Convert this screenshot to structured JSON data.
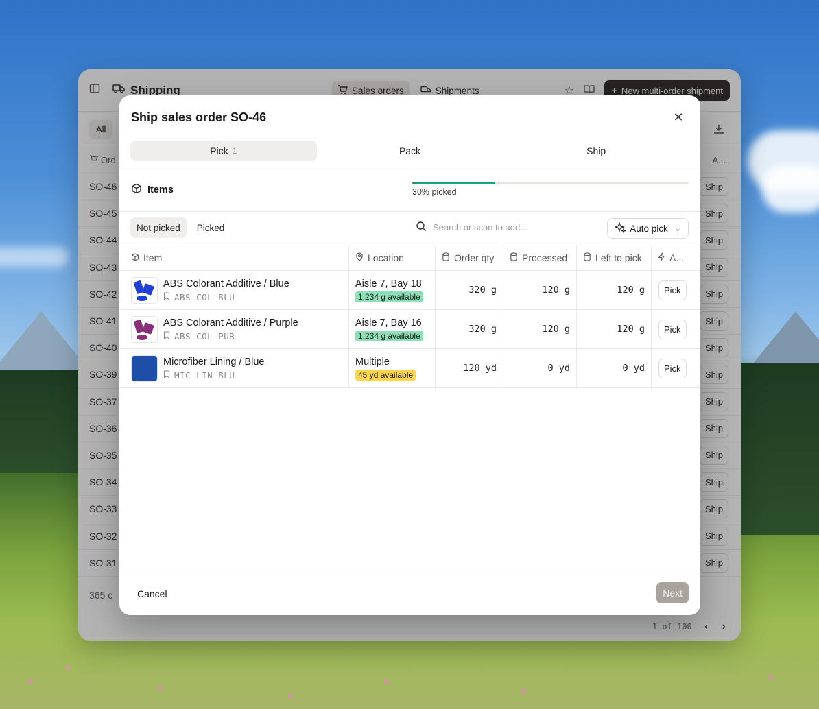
{
  "app": {
    "title": "Shipping",
    "nav": [
      {
        "label": "Sales orders",
        "active": true
      },
      {
        "label": "Shipments",
        "active": false
      }
    ],
    "new_shipment_label": "New multi-order shipment",
    "filter_all": "All",
    "column_order": "Ord",
    "column_a": "A...",
    "orders": [
      "SO-46",
      "SO-45",
      "SO-44",
      "SO-43",
      "SO-42",
      "SO-41",
      "SO-40",
      "SO-39",
      "SO-37",
      "SO-36",
      "SO-35",
      "SO-34",
      "SO-33",
      "SO-32",
      "SO-31"
    ],
    "ship_label": "Ship",
    "count_text": "365 c",
    "pager_text": "1 of 100"
  },
  "modal": {
    "title": "Ship sales order SO-46",
    "steps": [
      {
        "label": "Pick",
        "count": "1",
        "active": true
      },
      {
        "label": "Pack",
        "count": "",
        "active": false
      },
      {
        "label": "Ship",
        "count": "",
        "active": false
      }
    ],
    "items_label": "Items",
    "progress_percent": 30,
    "progress_text": "30% picked",
    "subtabs": [
      {
        "label": "Not picked",
        "active": true
      },
      {
        "label": "Picked",
        "active": false
      }
    ],
    "search_placeholder": "Search or scan to add...",
    "auto_pick_label": "Auto pick",
    "columns": {
      "item": "Item",
      "location": "Location",
      "order_qty": "Order qty",
      "processed": "Processed",
      "left_to_pick": "Left to pick",
      "actions": "A..."
    },
    "rows": [
      {
        "name": "ABS Colorant Additive / Blue",
        "sku": "ABS-COL-BLU",
        "location": "Aisle 7, Bay 18",
        "availability": "1,234 g available",
        "availability_color": "#8fe0b8",
        "order_qty": "320 g",
        "processed": "120 g",
        "left": "120 g",
        "action": "Pick",
        "thumb_color": "#1f3fd6"
      },
      {
        "name": "ABS Colorant Additive / Purple",
        "sku": "ABS-COL-PUR",
        "location": "Aisle 7, Bay 16",
        "availability": "1,234 g available",
        "availability_color": "#8fe0b8",
        "order_qty": "320 g",
        "processed": "120 g",
        "left": "120 g",
        "action": "Pick",
        "thumb_color": "#8a2f7a"
      },
      {
        "name": "Microfiber Lining / Blue",
        "sku": "MIC-LIN-BLU",
        "location": "Multiple",
        "availability": "45 yd available",
        "availability_color": "#ffd64a",
        "order_qty": "120 yd",
        "processed": "0 yd",
        "left": "0 yd",
        "action": "Pick",
        "thumb_color": "#1d4fa8"
      }
    ],
    "cancel_label": "Cancel",
    "next_label": "Next"
  }
}
